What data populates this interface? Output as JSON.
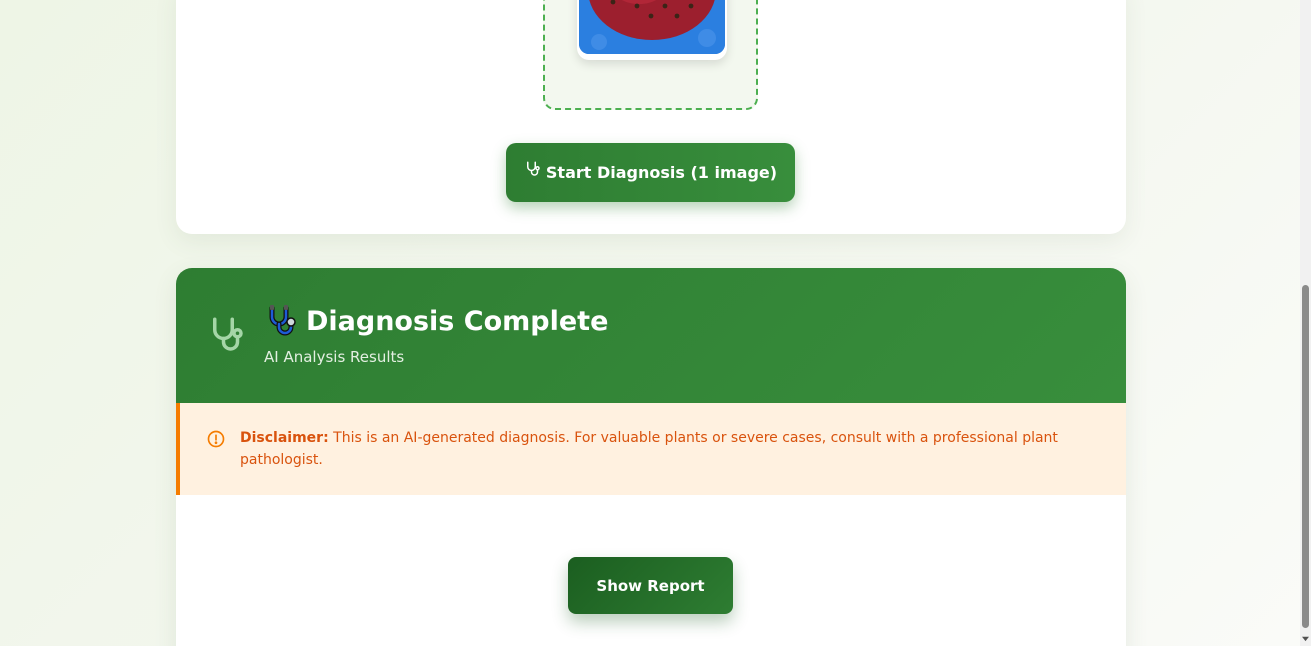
{
  "upload": {
    "start_button_label": "Start Diagnosis (1 image)",
    "icon": "stethoscope-icon"
  },
  "result": {
    "title": "Diagnosis Complete",
    "subtitle": "AI Analysis Results",
    "header_icon": "stethoscope-icon",
    "disclaimer_label": "Disclaimer:",
    "disclaimer_text": " This is an AI-generated diagnosis. For valuable plants or severe cases, consult with a professional plant pathologist.",
    "show_report_label": "Show Report"
  },
  "colors": {
    "primary_green": "#2e7d32",
    "dark_green": "#1b5e20",
    "warning_orange": "#f57c00",
    "warning_bg": "#fff1e0"
  }
}
